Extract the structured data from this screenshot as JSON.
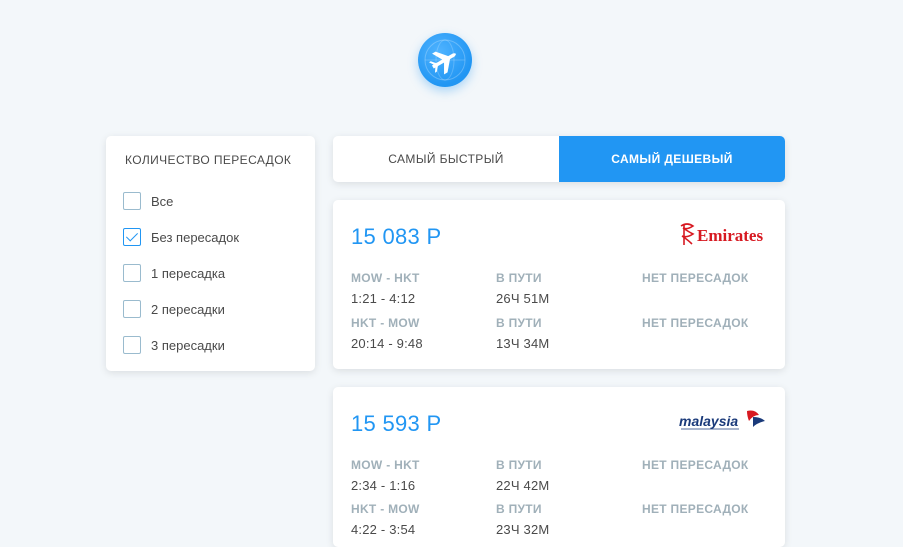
{
  "logo": {
    "icon": "airplane-icon"
  },
  "filter": {
    "title": "КОЛИЧЕСТВО ПЕРЕСАДОК",
    "options": [
      {
        "label": "Все",
        "checked": false
      },
      {
        "label": "Без пересадок",
        "checked": true
      },
      {
        "label": "1 пересадка",
        "checked": false
      },
      {
        "label": "2 пересадки",
        "checked": false
      },
      {
        "label": "3 пересадки",
        "checked": false
      }
    ]
  },
  "tabs": [
    {
      "label": "САМЫЙ БЫСТРЫЙ",
      "active": false
    },
    {
      "label": "САМЫЙ ДЕШЕВЫЙ",
      "active": true
    }
  ],
  "tickets": [
    {
      "price": "15 083 Р",
      "carrier": "Emirates",
      "segments": [
        {
          "route": "MOW - HKT",
          "time": "1:21 - 4:12",
          "duration_label": "В ПУТИ",
          "duration": "26Ч 51М",
          "stops": "НЕТ ПЕРЕСАДОК"
        },
        {
          "route": "HKT - MOW",
          "time": "20:14 - 9:48",
          "duration_label": "В ПУТИ",
          "duration": "13Ч 34М",
          "stops": "НЕТ ПЕРЕСАДОК"
        }
      ]
    },
    {
      "price": "15 593 Р",
      "carrier": "malaysia",
      "segments": [
        {
          "route": "MOW - HKT",
          "time": "2:34 - 1:16",
          "duration_label": "В ПУТИ",
          "duration": "22Ч 42М",
          "stops": "НЕТ ПЕРЕСАДОК"
        },
        {
          "route": "HKT - MOW",
          "time": "4:22 - 3:54",
          "duration_label": "В ПУТИ",
          "duration": "23Ч 32М",
          "stops": "НЕТ ПЕРЕСАДОК"
        }
      ]
    }
  ],
  "colors": {
    "accent": "#2196F3",
    "background": "#F3F7FA",
    "muted": "#A0B0B9",
    "emirates": "#D71921",
    "malaysia": "#1A3A7A"
  }
}
